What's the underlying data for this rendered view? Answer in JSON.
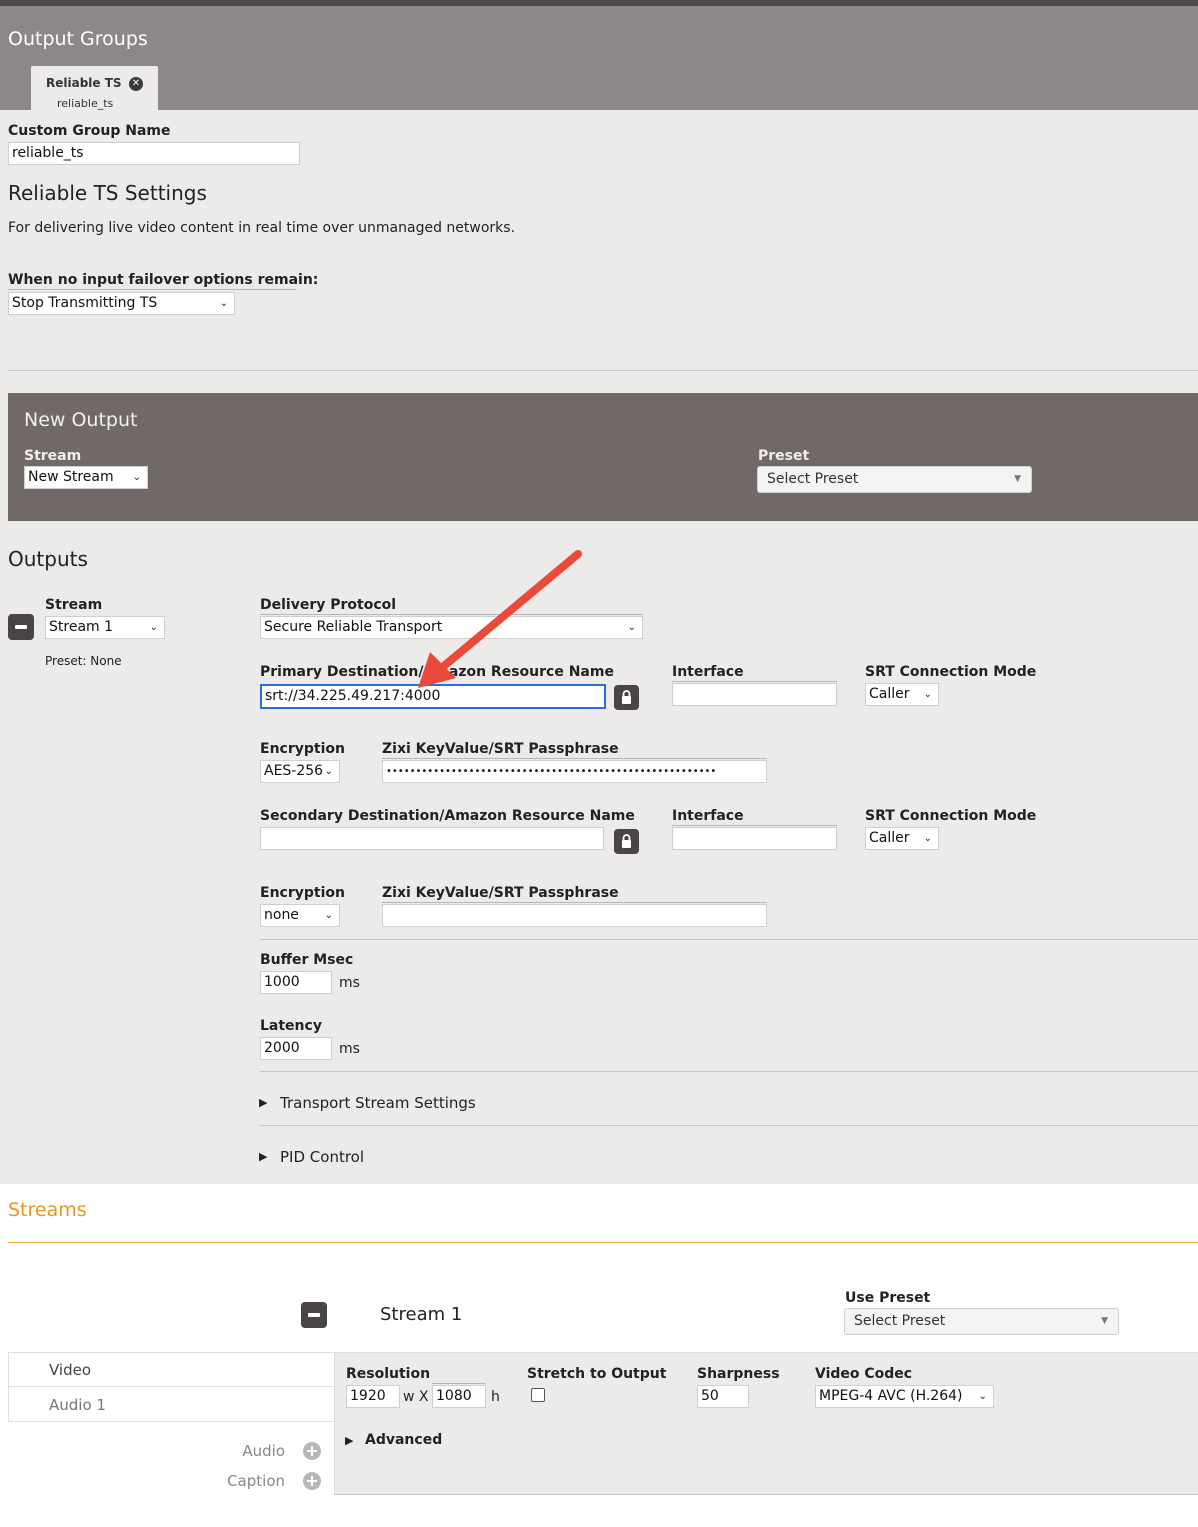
{
  "output_groups": {
    "title": "Output Groups",
    "tab": {
      "label": "Reliable TS",
      "sublabel": "reliable_ts"
    }
  },
  "group": {
    "custom_name_label": "Custom Group Name",
    "custom_name_value": "reliable_ts",
    "settings_title": "Reliable TS Settings",
    "description": "For delivering live video content in real time over unmanaged networks.",
    "failover_label": "When no input failover options remain:",
    "failover_value": "Stop Transmitting TS"
  },
  "new_output": {
    "title": "New Output",
    "stream_label": "Stream",
    "stream_value": "New Stream",
    "preset_label": "Preset",
    "preset_value": "Select Preset"
  },
  "outputs": {
    "title": "Outputs",
    "stream_label": "Stream",
    "stream_value": "Stream 1",
    "preset_text": "Preset: None",
    "delivery_label": "Delivery Protocol",
    "delivery_value": "Secure Reliable Transport",
    "primary_label": "Primary Destination/Amazon Resource Name",
    "primary_value": "srt://34.225.49.217:4000",
    "interface_label": "Interface",
    "interface_value": "",
    "srt_mode_label": "SRT Connection Mode",
    "srt_mode_value": "Caller",
    "encryption_label": "Encryption",
    "encryption_value": "AES-256",
    "passphrase_label": "Zixi KeyValue/SRT Passphrase",
    "passphrase_value": "••••••••••••••••••••••••••••••••••••••••••••••••••••••••",
    "secondary_label": "Secondary Destination/Amazon Resource Name",
    "secondary_value": "",
    "interface2_label": "Interface",
    "interface2_value": "",
    "srt_mode2_label": "SRT Connection Mode",
    "srt_mode2_value": "Caller",
    "encryption2_label": "Encryption",
    "encryption2_value": "none",
    "passphrase2_label": "Zixi KeyValue/SRT Passphrase",
    "passphrase2_value": "",
    "buffer_label": "Buffer Msec",
    "buffer_value": "1000",
    "buffer_unit": "ms",
    "latency_label": "Latency",
    "latency_value": "2000",
    "latency_unit": "ms",
    "ts_settings": "Transport Stream Settings",
    "pid_control": "PID Control"
  },
  "streams": {
    "title": "Streams",
    "stream_name": "Stream 1",
    "use_preset_label": "Use Preset",
    "use_preset_value": "Select Preset",
    "tabs": [
      "Video",
      "Audio 1"
    ],
    "add_audio": "Audio",
    "add_caption": "Caption",
    "resolution_label": "Resolution",
    "width": "1920",
    "w_x": "w X",
    "height": "1080",
    "h": "h",
    "stretch_label": "Stretch to Output",
    "sharpness_label": "Sharpness",
    "sharpness_value": "50",
    "codec_label": "Video Codec",
    "codec_value": "MPEG-4 AVC (H.264)",
    "advanced": "Advanced"
  },
  "colors": {
    "accent_orange": "#e8961e",
    "annotation_arrow": "#ea4a3a",
    "focus_blue": "#2a6fd8"
  }
}
